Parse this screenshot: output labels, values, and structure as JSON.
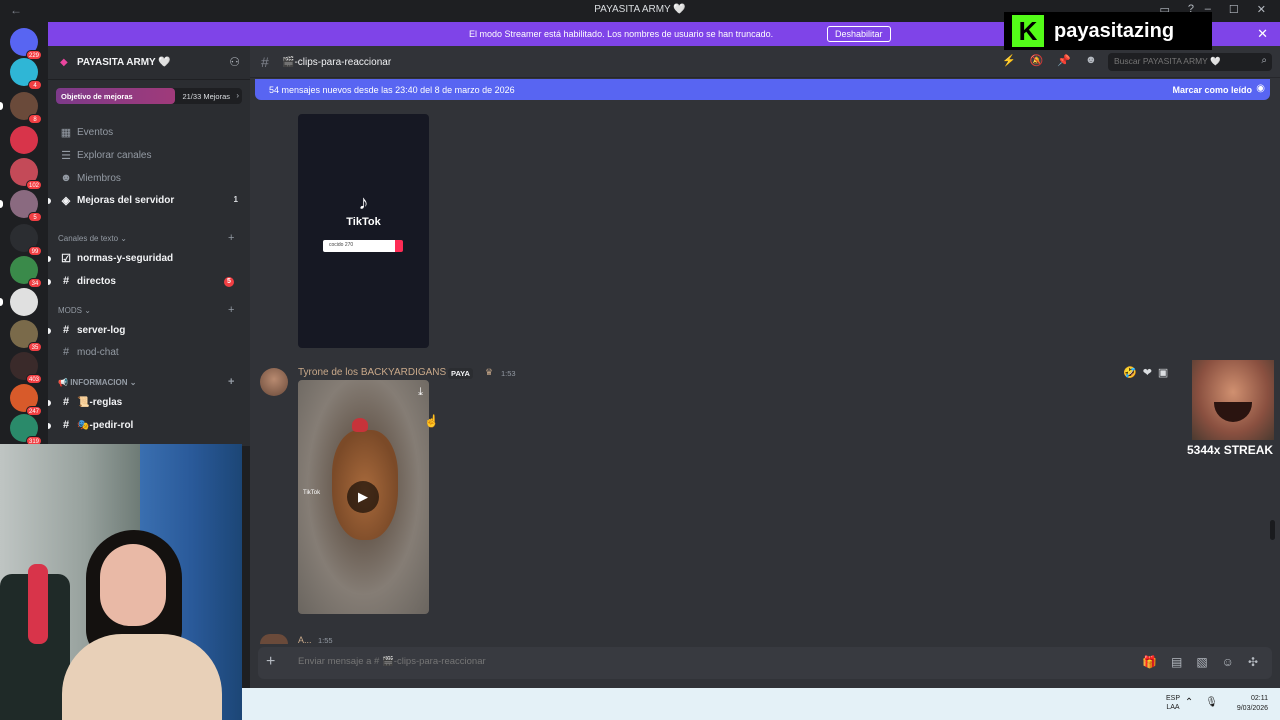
{
  "window": {
    "title": "PAYASITA ARMY 🤍"
  },
  "streamer_bar": {
    "message": "El modo Streamer está habilitado. Los nombres de usuario se han truncado.",
    "button": "Deshabilitar"
  },
  "server_badges": [
    "229",
    "4",
    "8",
    "",
    "102",
    "5",
    "99",
    "34",
    "",
    "35",
    "403",
    "247",
    "319"
  ],
  "sidebar": {
    "server_name": "PAYASITA ARMY 🤍",
    "boost_label": "Objetivo de mejoras",
    "boost_progress": "21/33 Mejoras",
    "boost_fraction": 0.64,
    "nav": [
      {
        "label": "Eventos"
      },
      {
        "label": "Explorar canales"
      },
      {
        "label": "Miembros"
      },
      {
        "label": "Mejoras del servidor",
        "count": "1"
      }
    ],
    "categories": [
      {
        "label": "Canales de texto"
      },
      {
        "label": "MODS"
      },
      {
        "label": "INFORMACION"
      }
    ],
    "channels_text": [
      {
        "label": "normas-y-seguridad"
      },
      {
        "label": "directos",
        "badge": "5"
      }
    ],
    "channels_mods": [
      {
        "label": "server-log"
      },
      {
        "label": "mod-chat"
      }
    ],
    "channels_info": [
      {
        "label": "📜-reglas"
      },
      {
        "label": "🎭-pedir-rol"
      }
    ]
  },
  "channel": {
    "name": "🎬-clips-para-reaccionar",
    "search_placeholder": "Buscar PAYASITA ARMY 🤍"
  },
  "new_messages": {
    "text": "54 mensajes nuevos desde las 23:40 del 8 de marzo de 2026",
    "action": "Marcar como leído"
  },
  "messages": [
    {
      "embed": {
        "brand": "TikTok",
        "search_text": "cocido 270"
      }
    },
    {
      "author": "Tyrone de los BACKYARDIGANS",
      "tag": "PAYA",
      "time": "1:53",
      "video_watermark": "TikTok"
    },
    {
      "author": "A...",
      "time": "1:55"
    }
  ],
  "composer": {
    "placeholder": "Enviar mensaje a # 🎬-clips-para-reaccionar"
  },
  "overlay": {
    "kick_name": "payasitazing",
    "streak": "5344x STREAK"
  },
  "taskbar": {
    "lang1": "ESP",
    "lang2": "LAA",
    "time": "02:11",
    "date": "9/03/2026"
  }
}
